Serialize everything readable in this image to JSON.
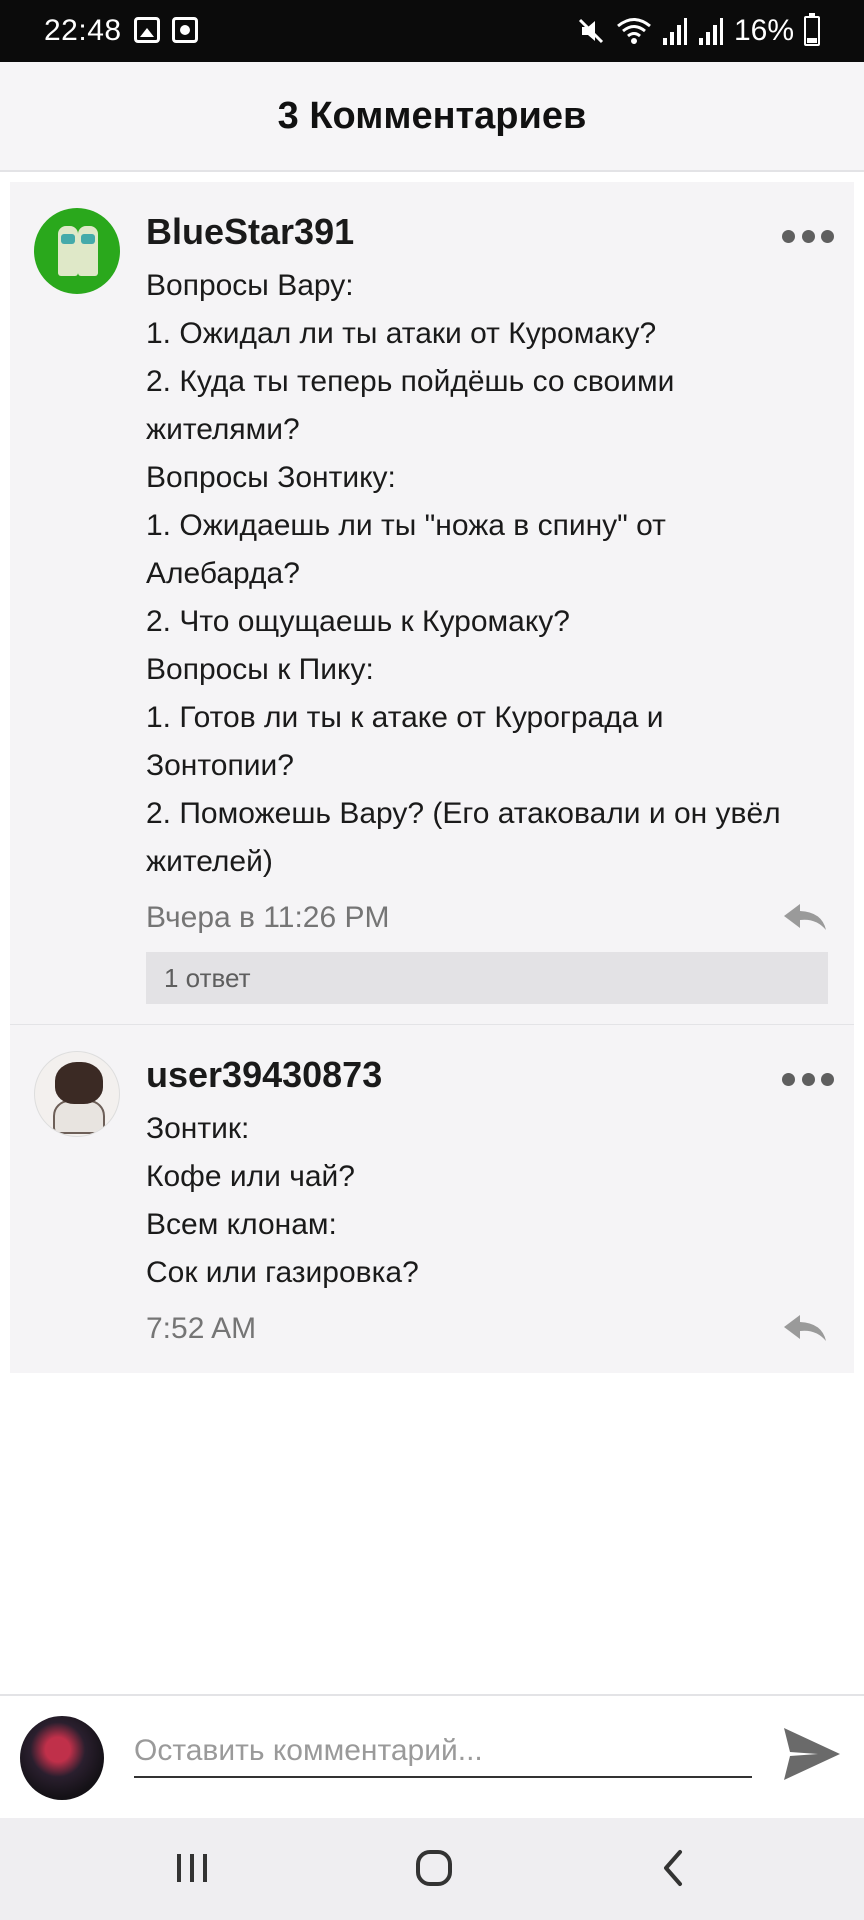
{
  "status_bar": {
    "time": "22:48",
    "battery_percent": "16%",
    "icons": [
      "gallery-icon",
      "screen-record-icon",
      "mute-icon",
      "wifi-icon",
      "signal-icon",
      "signal-icon",
      "battery-icon"
    ]
  },
  "header": {
    "title": "3 Комментариев"
  },
  "comments": [
    {
      "username": "BlueStar391",
      "lines": [
        "Вопросы Вару:",
        "1. Ожидал ли ты атаки от Куромаку?",
        "2. Куда ты теперь пойдёшь со своими",
        "жителями?",
        "Вопросы Зонтику:",
        "1. Ожидаешь ли ты \"ножа в спину\" от",
        "Алебарда?",
        "2. Что ощущаешь к Куромаку?",
        "Вопросы к Пику:",
        "1. Готов ли ты к атаке от Курограда и",
        "Зонтопии?",
        "2. Поможешь Вару? (Его атаковали и он увёл",
        "жителей)"
      ],
      "timestamp": "Вчера в 11:26 PM",
      "replies_label": "1 ответ"
    },
    {
      "username": "user39430873",
      "lines": [
        "Зонтик:",
        "Кофе или чай?",
        "Всем клонам:",
        "Сок или газировка?"
      ],
      "timestamp": "7:52 AM"
    }
  ],
  "composer": {
    "placeholder": "Оставить комментарий..."
  },
  "colors": {
    "status_bar": "#0b0b0b",
    "header_bg": "#f6f5f7",
    "comment_bg": "#f5f4f6",
    "timestamp": "#757575",
    "icon_gray": "#5f5f5f"
  }
}
